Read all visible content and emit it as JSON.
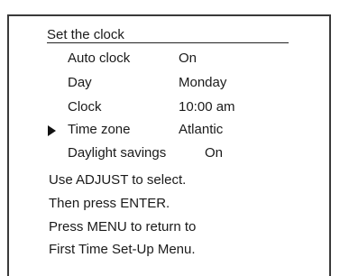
{
  "menu": {
    "title": "Set the clock",
    "rows": [
      {
        "label": "Auto clock",
        "value": "On"
      },
      {
        "label": "Day",
        "value": "Monday"
      },
      {
        "label": "Clock",
        "value": "10:00 am"
      },
      {
        "label": "Time zone",
        "value": "Atlantic"
      },
      {
        "label": "Daylight savings",
        "value": "On"
      }
    ]
  },
  "instructions": [
    "Use ADJUST to select.",
    "Then press ENTER.",
    "Press MENU to return to",
    "First Time Set-Up Menu."
  ]
}
